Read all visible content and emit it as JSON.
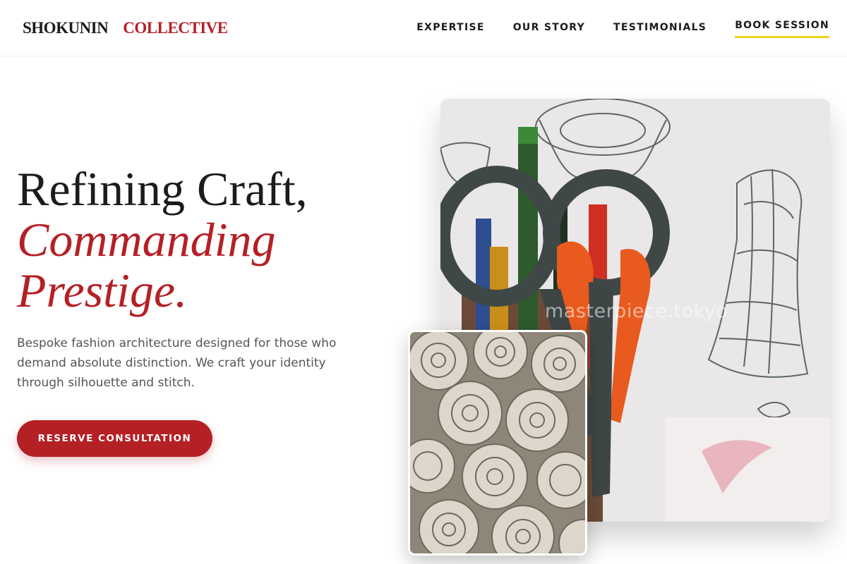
{
  "brand": {
    "part1": "SHOKUNIN",
    "part2": "COLLECTIVE"
  },
  "nav": {
    "items": [
      {
        "label": "EXPERTISE"
      },
      {
        "label": "OUR STORY"
      },
      {
        "label": "TESTIMONIALS"
      },
      {
        "label": "BOOK SESSION"
      }
    ]
  },
  "hero": {
    "title_line1": "Refining Craft,",
    "title_line2": "Commanding",
    "title_line3": "Prestige.",
    "description": "Bespoke fashion architecture designed for those who demand absolute distinction. We craft your identity through silhouette and stitch.",
    "cta_label": "RESERVE CONSULTATION"
  },
  "images": {
    "main_watermark": "masterpiece.tokyo"
  },
  "colors": {
    "accent": "#b52025",
    "nav_underline": "#f2d21a",
    "text": "#1c1c1c"
  }
}
